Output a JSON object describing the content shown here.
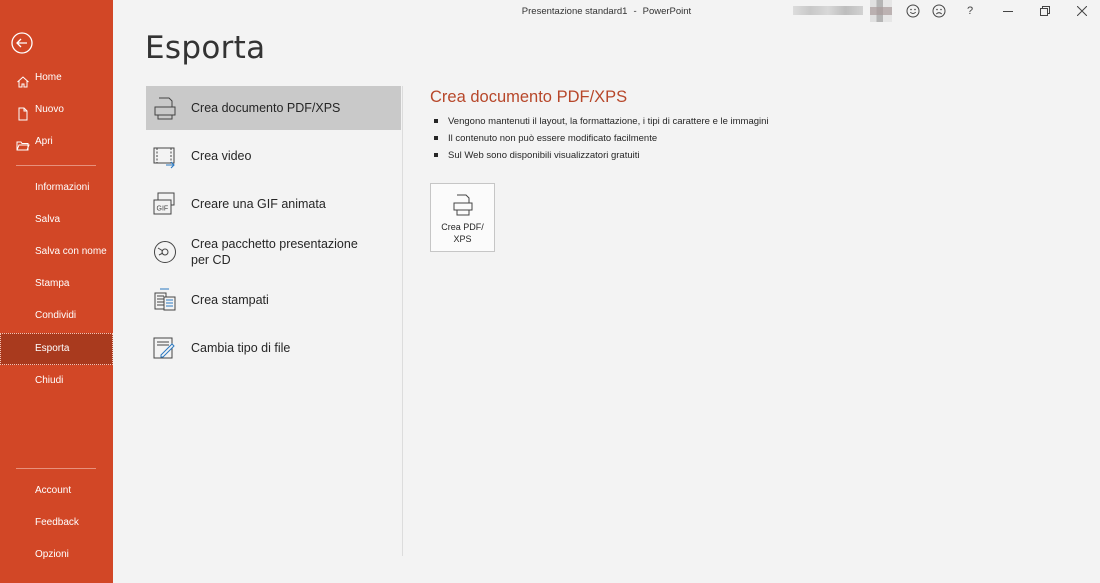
{
  "window": {
    "title_doc": "Presentazione standard1",
    "title_sep": "-",
    "title_app": "PowerPoint"
  },
  "titlebar_icons": [
    "smile-icon",
    "frown-icon",
    "help-icon",
    "minimize-icon",
    "restore-icon",
    "close-icon"
  ],
  "titlebar_glyphs": {
    "help": "?"
  },
  "sidebar": {
    "top_items": [
      {
        "label": "Home",
        "icon": "home-icon"
      },
      {
        "label": "Nuovo",
        "icon": "new-document-icon"
      },
      {
        "label": "Apri",
        "icon": "open-folder-icon"
      }
    ],
    "middle_items": [
      {
        "label": "Informazioni"
      },
      {
        "label": "Salva"
      },
      {
        "label": "Salva con nome"
      },
      {
        "label": "Stampa"
      },
      {
        "label": "Condividi"
      },
      {
        "label": "Esporta",
        "active": true
      },
      {
        "label": "Chiudi"
      }
    ],
    "bottom_items": [
      {
        "label": "Account"
      },
      {
        "label": "Feedback"
      },
      {
        "label": "Opzioni"
      }
    ]
  },
  "main": {
    "page_title": "Esporta",
    "options": [
      {
        "label": "Crea documento PDF/XPS",
        "icon": "pdf-document-icon",
        "selected": true
      },
      {
        "label": "Crea video",
        "icon": "video-icon"
      },
      {
        "label": "Creare una GIF animata",
        "icon": "gif-icon",
        "icon_text": "GIF"
      },
      {
        "label": "Crea pacchetto presentazione per CD",
        "line1": "Crea pacchetto presentazione",
        "line2": "per CD",
        "icon": "cd-icon"
      },
      {
        "label": "Crea stampati",
        "icon": "handouts-icon"
      },
      {
        "label": "Cambia tipo di file",
        "icon": "change-file-type-icon"
      }
    ],
    "detail": {
      "title": "Crea documento PDF/XPS",
      "bullets": [
        "Vengono mantenuti il layout, la formattazione, i tipi di carattere e le immagini",
        "Il contenuto non può essere modificato facilmente",
        "Sul Web sono disponibili visualizzatori gratuiti"
      ],
      "button_label": "Crea PDF/\nXPS"
    }
  },
  "colors": {
    "sidebar": "#d24726",
    "sidebar_active": "#a93a1e",
    "accent_title": "#b7472a",
    "selected_option": "#c9c9c9"
  }
}
